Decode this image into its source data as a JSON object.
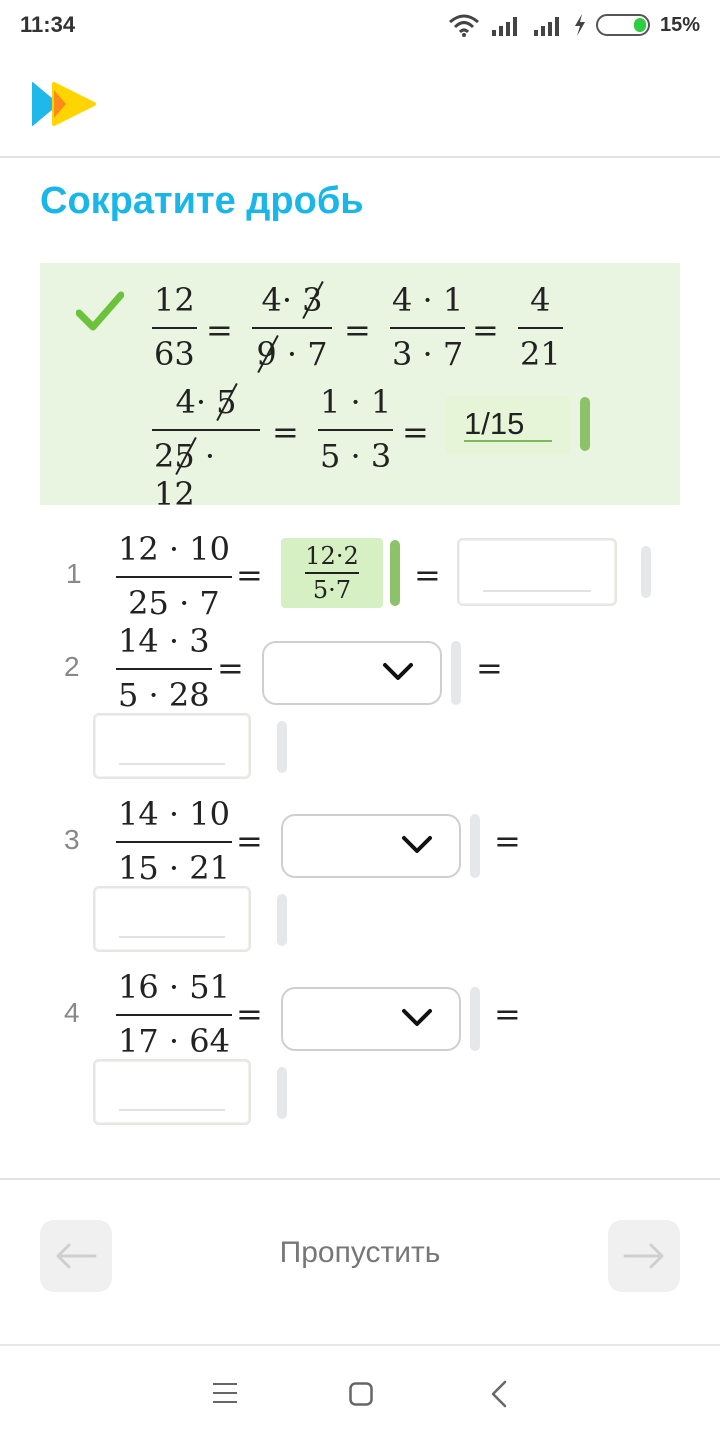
{
  "status": {
    "time": "11:34",
    "battery_pct": "15%"
  },
  "colors": {
    "title": "#1ab6e8",
    "example_bg": "#eaf5e1",
    "ok_green": "#8dc26b"
  },
  "title": "Сократите дробь",
  "example": {
    "row1": [
      {
        "num": "12",
        "den": "63"
      },
      {
        "num_a": "4·",
        "num_b": "3",
        "den_a": "9",
        "den_b": "· 7"
      },
      {
        "num": "4 · 1",
        "den": "3 · 7"
      },
      {
        "num": "4",
        "den": "21"
      }
    ],
    "row2": [
      {
        "num_a": "4·",
        "num_b": "5",
        "den_a": "2",
        "den_b": "5",
        "den_c": " · 12"
      },
      {
        "num": "1 · 1",
        "den": "5 · 3"
      }
    ],
    "answer": "1/15",
    "eq": "="
  },
  "tasks": [
    {
      "n": "1",
      "num": "12 · 10",
      "den": "25 · 7",
      "filled_num": "12·2",
      "filled_den": "5·7"
    },
    {
      "n": "2",
      "num": "14 · 3",
      "den": "5 · 28"
    },
    {
      "n": "3",
      "num": "14 · 10",
      "den": "15 · 21"
    },
    {
      "n": "4",
      "num": "16 · 51",
      "den": "17 · 64"
    }
  ],
  "footer": {
    "skip_label": "Пропустить"
  }
}
